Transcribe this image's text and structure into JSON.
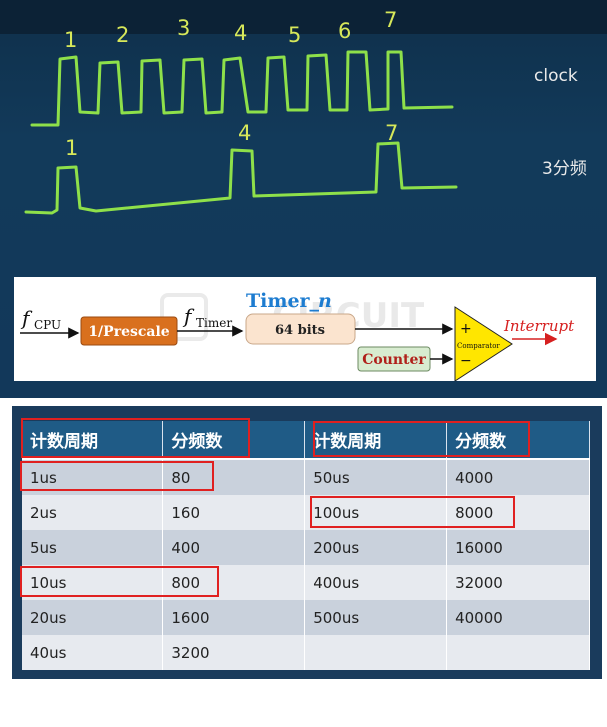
{
  "clock_diagram": {
    "clock_label": "clock",
    "divided_label": "3分频",
    "pulse_numbers": [
      "1",
      "2",
      "3",
      "4",
      "5",
      "6",
      "7"
    ],
    "divided_pulse_numbers": [
      "1",
      "4",
      "7"
    ]
  },
  "block_diagram": {
    "f_cpu": "f",
    "f_cpu_sub": "CPU",
    "prescale": "1/Prescale",
    "f_timer": "f",
    "f_timer_sub": "Timer",
    "timer_title": "Timer_",
    "timer_title_n": "n",
    "timer_bits": "64 bits",
    "counter": "Counter",
    "comparator": "Comparator",
    "interrupt": "Interrupt",
    "watermark": "CIRCUIT DIGEST",
    "colors": {
      "prescale": "#d9701e",
      "timer_box": "#fbe4cf",
      "counter": "#d8ecd0",
      "comparator": "#ffe600",
      "timer_title": "#1d7cd0",
      "interrupt": "#d62020"
    }
  },
  "table": {
    "headers": [
      "计数周期",
      "分频数",
      "计数周期",
      "分频数"
    ],
    "rows": [
      [
        "1us",
        "80",
        "50us",
        "4000"
      ],
      [
        "2us",
        "160",
        "100us",
        "8000"
      ],
      [
        "5us",
        "400",
        "200us",
        "16000"
      ],
      [
        "10us",
        "800",
        "400us",
        "32000"
      ],
      [
        "20us",
        "1600",
        "500us",
        "40000"
      ],
      [
        "40us",
        "3200",
        "",
        ""
      ]
    ]
  }
}
